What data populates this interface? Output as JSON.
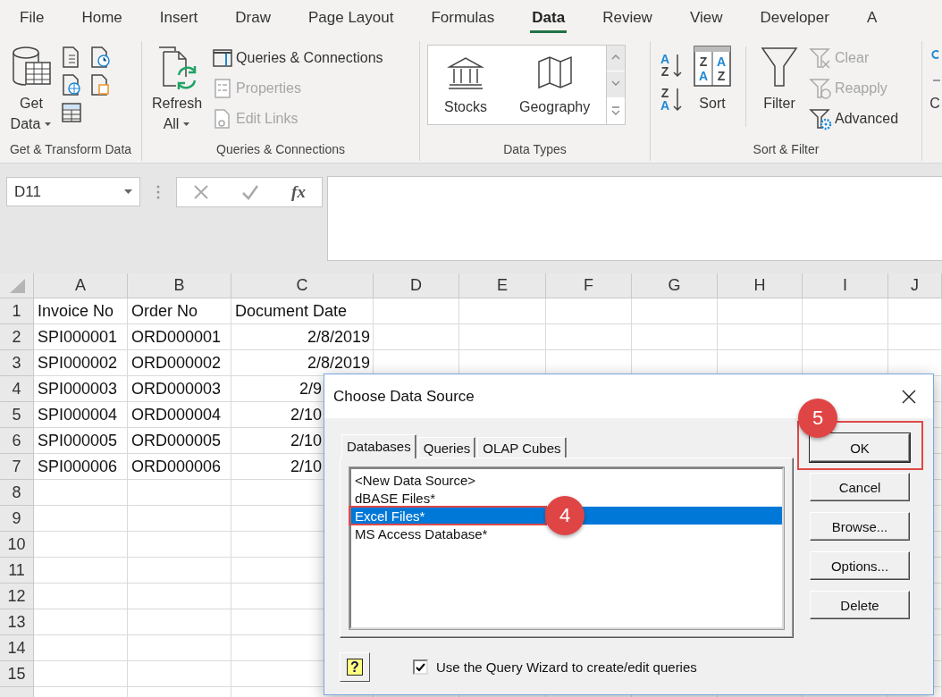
{
  "ribbon_tabs": [
    {
      "label": "File",
      "selected": false
    },
    {
      "label": "Home",
      "selected": false
    },
    {
      "label": "Insert",
      "selected": false
    },
    {
      "label": "Draw",
      "selected": false
    },
    {
      "label": "Page Layout",
      "selected": false
    },
    {
      "label": "Formulas",
      "selected": false
    },
    {
      "label": "Data",
      "selected": true
    },
    {
      "label": "Review",
      "selected": false
    },
    {
      "label": "View",
      "selected": false
    },
    {
      "label": "Developer",
      "selected": false
    },
    {
      "label": "A",
      "selected": false
    }
  ],
  "ribbon_groups": [
    {
      "label": "Get & Transform Data",
      "commands": [
        {
          "kind": "large",
          "label": "Get Data",
          "dropdown": true
        },
        {
          "kind": "icon-grid"
        }
      ]
    },
    {
      "label": "Queries & Connections",
      "commands": [
        {
          "kind": "large",
          "label": "Refresh All",
          "dropdown": true
        },
        {
          "kind": "small",
          "label": "Queries & Connections",
          "disabled": false
        },
        {
          "kind": "small",
          "label": "Properties",
          "disabled": true
        },
        {
          "kind": "small",
          "label": "Edit Links",
          "disabled": true
        }
      ]
    },
    {
      "label": "Data Types",
      "commands": [
        {
          "kind": "gallery",
          "items": [
            "Stocks",
            "Geography"
          ]
        }
      ]
    },
    {
      "label": "Sort & Filter",
      "commands": [
        {
          "kind": "sort-pair",
          "glyphs": [
            [
              "A",
              "Z"
            ],
            [
              "Z",
              "A"
            ]
          ]
        },
        {
          "kind": "large",
          "label": "Sort",
          "glyphs": [
            "Z",
            "A",
            "A",
            "Z"
          ]
        },
        {
          "kind": "large",
          "label": "Filter"
        },
        {
          "kind": "small",
          "label": "Clear",
          "disabled": true
        },
        {
          "kind": "small",
          "label": "Reapply",
          "disabled": true
        },
        {
          "kind": "small",
          "label": "Advanced",
          "disabled": false
        }
      ]
    },
    {
      "commands": [
        {
          "kind": "large",
          "label": "C"
        }
      ]
    }
  ],
  "formula_bar": {
    "name_box": "D11",
    "function_label": "fx"
  },
  "sheet": {
    "columns": [
      "A",
      "B",
      "C",
      "D",
      "E",
      "F",
      "G",
      "H",
      "I",
      "J"
    ],
    "rows": [
      {
        "number": "1",
        "cells": [
          "Invoice No",
          "Order No",
          "Document Date"
        ]
      },
      {
        "number": "2",
        "cells": [
          "SPI000001",
          "ORD000001",
          "2/8/2019"
        ]
      },
      {
        "number": "3",
        "cells": [
          "SPI000002",
          "ORD000002",
          "2/8/2019"
        ]
      },
      {
        "number": "4",
        "cells": [
          "SPI000003",
          "ORD000003",
          "2/9"
        ]
      },
      {
        "number": "5",
        "cells": [
          "SPI000004",
          "ORD000004",
          "2/10"
        ]
      },
      {
        "number": "6",
        "cells": [
          "SPI000005",
          "ORD000005",
          "2/10"
        ]
      },
      {
        "number": "7",
        "cells": [
          "SPI000006",
          "ORD000006",
          "2/10"
        ]
      },
      {
        "number": "8",
        "cells": []
      },
      {
        "number": "9",
        "cells": []
      },
      {
        "number": "10",
        "cells": []
      },
      {
        "number": "11",
        "cells": []
      },
      {
        "number": "12",
        "cells": []
      },
      {
        "number": "13",
        "cells": []
      },
      {
        "number": "14",
        "cells": []
      },
      {
        "number": "15",
        "cells": []
      }
    ]
  },
  "dialog": {
    "title": "Choose Data Source",
    "tabs": [
      {
        "label": "Databases",
        "selected": true
      },
      {
        "label": "Queries",
        "selected": false
      },
      {
        "label": "OLAP Cubes",
        "selected": false
      }
    ],
    "list": [
      {
        "label": "<New Data Source>",
        "selected": false
      },
      {
        "label": "dBASE Files*",
        "selected": false
      },
      {
        "label": "Excel Files*",
        "selected": true
      },
      {
        "label": "MS Access Database*",
        "selected": false
      }
    ],
    "buttons": [
      "OK",
      "Cancel",
      "Browse...",
      "Options...",
      "Delete"
    ],
    "help_button": "?",
    "checkbox": {
      "label": "Use the Query Wizard to create/edit queries",
      "checked": true
    },
    "annotations": [
      {
        "label": "5"
      },
      {
        "label": "4"
      }
    ]
  }
}
